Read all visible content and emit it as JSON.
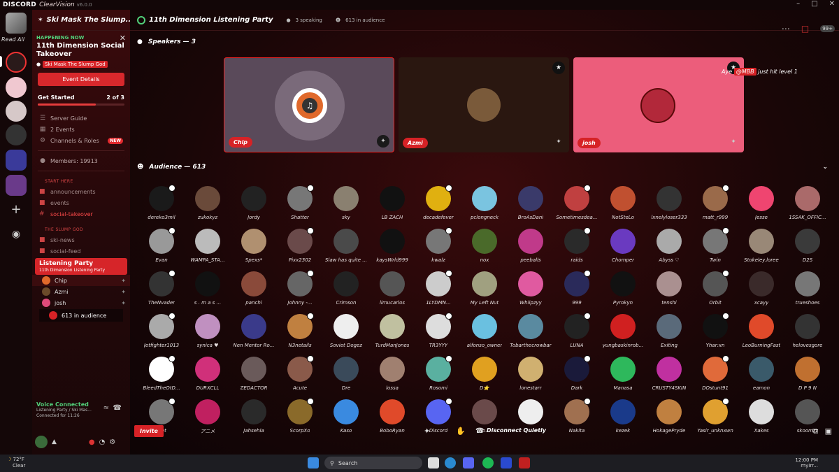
{
  "titlebar": {
    "brand": "DISCORD",
    "brand2": "ClearVision",
    "version": "v6.0.0"
  },
  "rail": {
    "read_all": "Read All"
  },
  "server": {
    "name": "Ski Mask The Slump..."
  },
  "happening": {
    "label": "HAPPENING NOW",
    "title": "11th Dimension Social Takeover",
    "host": "Ski Mask The Slump God",
    "button": "Event Details"
  },
  "get_started": {
    "label": "Get Started",
    "progress_text": "2 of 3",
    "progress": 0.67
  },
  "nav": [
    {
      "label": "Server Guide",
      "icon": "guide-icon"
    },
    {
      "label": "2 Events",
      "icon": "calendar-icon"
    },
    {
      "label": "Channels & Roles",
      "icon": "channels-icon",
      "badge": "NEW"
    }
  ],
  "members_label": "Members: 19913",
  "categories": {
    "start": "START HERE",
    "slump": "THE SLUMP GOD"
  },
  "channels_start": [
    {
      "label": "announcements"
    },
    {
      "label": "events"
    },
    {
      "label": "social-takeover",
      "active": true
    }
  ],
  "channels_slump": [
    {
      "label": "ski-news"
    },
    {
      "label": "social-feed"
    }
  ],
  "stage_channel": {
    "title": "Listening Party",
    "subtitle": "11th Dimension Listening Party",
    "members": [
      {
        "name": "Chip",
        "color": "#e0692b"
      },
      {
        "name": "Azmi",
        "color": "#6b4a2a"
      },
      {
        "name": "josh",
        "color": "#e04a7a"
      }
    ],
    "audience_text": "613 in audience"
  },
  "voice": {
    "status": "Voice Connected",
    "detail": "Listening Party / Ski Mas...",
    "duration": "Connected for 11:26"
  },
  "topbar": {
    "title": "11th Dimension Listening Party",
    "speaking": "3 speaking",
    "audience": "613 in audience",
    "badge": "99+"
  },
  "speakers_header": "Speakers — 3",
  "speakers": [
    {
      "name": "Chip",
      "bg": "#5a4a5a",
      "av": "#e0692b"
    },
    {
      "name": "Azmi",
      "bg": "#2a1710",
      "av": "#7a5a3a"
    },
    {
      "name": "josh",
      "bg": "#ec5d7b",
      "av": "#b2283a"
    }
  ],
  "level_up": {
    "prefix": "Aye",
    "user": "@MBB",
    "suffix": "just hit level 1"
  },
  "audience_header": "Audience — 613",
  "audience": [
    {
      "n": "dereko3mil",
      "c": "#1a1a1a"
    },
    {
      "n": "zukokyz",
      "c": "#6a4a3a"
    },
    {
      "n": "Jordy",
      "c": "#222"
    },
    {
      "n": "Shatter",
      "c": "#777"
    },
    {
      "n": "sky",
      "c": "#8a8070"
    },
    {
      "n": "LB ZACH",
      "c": "#111"
    },
    {
      "n": "decadefever",
      "c": "#e0b010"
    },
    {
      "n": "pclongneck",
      "c": "#7ac4e0"
    },
    {
      "n": "BroAsDani",
      "c": "#3a3a6a"
    },
    {
      "n": "Sometimesdea...",
      "c": "#c04040"
    },
    {
      "n": "NotSteLo",
      "c": "#c05030"
    },
    {
      "n": "lxnelyloser333",
      "c": "#333"
    },
    {
      "n": "matt_r999",
      "c": "#9a6a4a"
    },
    {
      "n": "Jesse",
      "c": "#ef4570"
    },
    {
      "n": "1SSAK_OFFIC...",
      "c": "#aa6a6a"
    },
    {
      "n": "Evan",
      "c": "#999"
    },
    {
      "n": "WAMPA_STA...",
      "c": "#bbb"
    },
    {
      "n": "Spexs*",
      "c": "#b09070"
    },
    {
      "n": "Pixx2302",
      "c": "#6a4a4a"
    },
    {
      "n": "Slaw has quite ...",
      "c": "#4a4a4a"
    },
    {
      "n": "kaysWrld999",
      "c": "#111"
    },
    {
      "n": "kwalz",
      "c": "#777"
    },
    {
      "n": "nox",
      "c": "#4a6a2a"
    },
    {
      "n": "peeballs",
      "c": "#c03a8a"
    },
    {
      "n": "raids",
      "c": "#2a2a2a"
    },
    {
      "n": "Chomper",
      "c": "#6a3ac0"
    },
    {
      "n": "Abyss ♡",
      "c": "#aaa"
    },
    {
      "n": "Twin",
      "c": "#777"
    },
    {
      "n": "Stokeley.loree",
      "c": "#998877"
    },
    {
      "n": "D2S",
      "c": "#3a3a3a"
    },
    {
      "n": "TheNvader",
      "c": "#333"
    },
    {
      "n": "s . m a s ...",
      "c": "#111"
    },
    {
      "n": "panchi",
      "c": "#8a4a3a"
    },
    {
      "n": "Johnny -...",
      "c": "#666"
    },
    {
      "n": "Crimson",
      "c": "#222"
    },
    {
      "n": "limucarlos",
      "c": "#555"
    },
    {
      "n": "1LYDMN...",
      "c": "#ccc"
    },
    {
      "n": "My Left Nut",
      "c": "#a0a080"
    },
    {
      "n": "Whiipzyy",
      "c": "#e05aa0"
    },
    {
      "n": "999",
      "c": "#2a2a5a"
    },
    {
      "n": "Pyrokyn",
      "c": "#111"
    },
    {
      "n": "tenshi",
      "c": "#aa9090"
    },
    {
      "n": "Orbit",
      "c": "#555"
    },
    {
      "n": "xcayy",
      "c": "#3a2a2a"
    },
    {
      "n": "trueshoes",
      "c": "#777"
    },
    {
      "n": "Jetfighter1013",
      "c": "#aaa"
    },
    {
      "n": "synica ♥",
      "c": "#c090c0"
    },
    {
      "n": "Nen Mentor Ro...",
      "c": "#3a3a8a"
    },
    {
      "n": "N3netails",
      "c": "#c08040"
    },
    {
      "n": "Soviet Dogez",
      "c": "#eee"
    },
    {
      "n": "TurdManJones",
      "c": "#c0c0a0"
    },
    {
      "n": "TR3YYY",
      "c": "#ddd"
    },
    {
      "n": "alfonso_owner",
      "c": "#6ac0e0"
    },
    {
      "n": "Tobarthecrowbar",
      "c": "#5a8aa0"
    },
    {
      "n": "LUNA",
      "c": "#222"
    },
    {
      "n": "yungbaskinrob...",
      "c": "#d02020"
    },
    {
      "n": "Exiting",
      "c": "#5a6a7a"
    },
    {
      "n": "Yhar:xn",
      "c": "#111"
    },
    {
      "n": "LeoBurningFast",
      "c": "#e04a2a"
    },
    {
      "n": "helovesgore",
      "c": "#333"
    },
    {
      "n": "BleedTheOtD...",
      "c": "#fff"
    },
    {
      "n": "DURXCLL",
      "c": "#d0307a"
    },
    {
      "n": "ZEDACTOR",
      "c": "#6a5a5a"
    },
    {
      "n": "Acute",
      "c": "#8a5a4a"
    },
    {
      "n": "Dre",
      "c": "#3a4a5a"
    },
    {
      "n": "lossa",
      "c": "#a08070"
    },
    {
      "n": "Rosomi",
      "c": "#5ab0a0"
    },
    {
      "n": "D⭐",
      "c": "#e0a020"
    },
    {
      "n": "lonestarr",
      "c": "#d0b070"
    },
    {
      "n": "Dark",
      "c": "#1a1a3a"
    },
    {
      "n": "Manasa",
      "c": "#2eb85c"
    },
    {
      "n": "CRUSTY4SKIN",
      "c": "#c030a0"
    },
    {
      "n": "DOstunt91",
      "c": "#e06a3a"
    },
    {
      "n": "eamon",
      "c": "#3a5a6a"
    },
    {
      "n": "D P 9 N",
      "c": "#c07030"
    },
    {
      "n": "...et",
      "c": "#777"
    },
    {
      "n": "アニメ",
      "c": "#c02060"
    },
    {
      "n": "Jahsehia",
      "c": "#2a2a2a"
    },
    {
      "n": "ScorpXo",
      "c": "#8a6a2a"
    },
    {
      "n": "Kaso",
      "c": "#3a8ae0"
    },
    {
      "n": "BoboRyan",
      "c": "#e04a2a"
    },
    {
      "n": "Discord",
      "c": "#5865f2"
    },
    {
      "n": "Ro...",
      "c": "#6a4a4a"
    },
    {
      "n": "...",
      "c": "#eee"
    },
    {
      "n": "Nakita",
      "c": "#a07050"
    },
    {
      "n": "kezek",
      "c": "#1a3a8a"
    },
    {
      "n": "HokagePryde",
      "c": "#c08040"
    },
    {
      "n": "Yasir_unknxwn",
      "c": "#e0a030"
    },
    {
      "n": "Xakes",
      "c": "#ddd"
    },
    {
      "n": "skoomzz",
      "c": "#555"
    }
  ],
  "controls": {
    "invite": "Invite",
    "disconnect": "Disconnect Quietly"
  },
  "taskbar": {
    "temp": "72°F",
    "cond": "Clear",
    "search_placeholder": "Search",
    "time": "12:00 PM",
    "tray_text": "myIrr..."
  }
}
